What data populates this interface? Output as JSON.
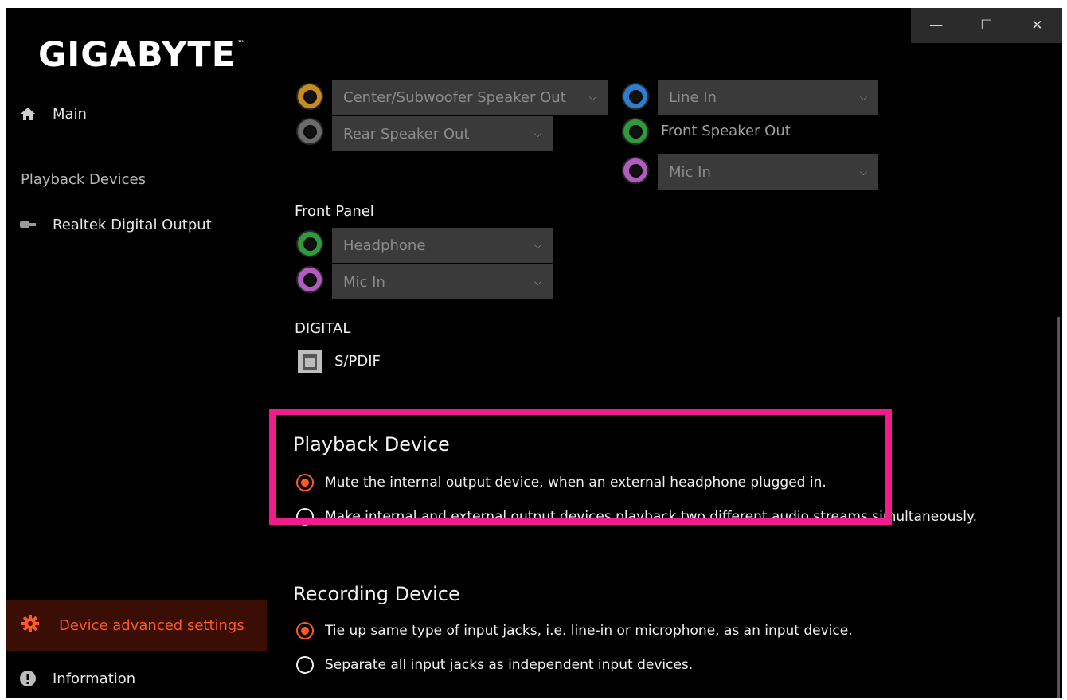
{
  "window": {
    "minimize": "—",
    "maximize": "☐",
    "close": "✕"
  },
  "brand": {
    "logo": "GIGABYTE",
    "tm": "™"
  },
  "sidebar": {
    "main": "Main",
    "section": "Playback Devices",
    "device": "Realtek Digital Output",
    "active_item": "Device advanced settings",
    "info": "Information"
  },
  "rear_panel": {
    "left": [
      {
        "color": "#c98b1c",
        "value": "Center/Subwoofer Speaker Out"
      },
      {
        "color": "#6b6b6b",
        "value": "Rear Speaker Out"
      }
    ],
    "right": [
      {
        "color": "#2a7fd4",
        "value": "Line In"
      },
      {
        "color": "#2e9c3c",
        "label": "Front Speaker Out"
      },
      {
        "color": "#b05cc0",
        "value": "Mic In"
      }
    ]
  },
  "front_panel": {
    "title": "Front Panel",
    "jacks": [
      {
        "color": "#2e9c3c",
        "value": "Headphone"
      },
      {
        "color": "#b05cc0",
        "value": "Mic In"
      }
    ]
  },
  "digital": {
    "title": "DIGITAL",
    "label": "S/PDIF"
  },
  "playback": {
    "title": "Playback Device",
    "options": [
      {
        "label": "Mute the internal output device, when an external headphone plugged in.",
        "selected": true
      },
      {
        "label": "Make internal and external output devices playback two different audio streams simultaneously.",
        "selected": false
      }
    ]
  },
  "recording": {
    "title": "Recording Device",
    "options": [
      {
        "label": "Tie up same type of input jacks, i.e. line-in or microphone, as an input device.",
        "selected": true
      },
      {
        "label": "Separate all input jacks as independent input devices.",
        "selected": false
      }
    ]
  },
  "colors": {
    "accent": "#ff5a1f",
    "highlight": "#ee1c8c"
  }
}
